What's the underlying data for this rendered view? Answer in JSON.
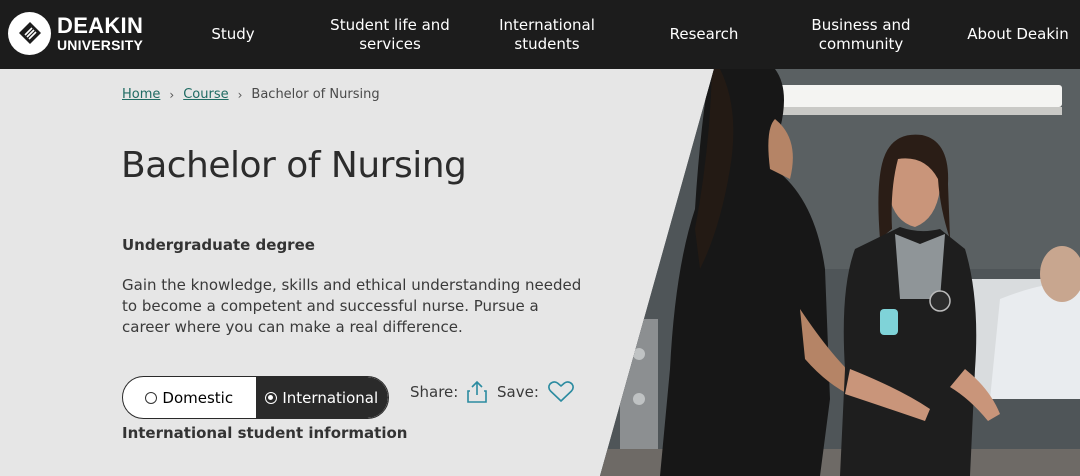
{
  "brand": {
    "name_line1": "DEAKIN",
    "name_line2": "UNIVERSITY"
  },
  "nav": {
    "items": [
      {
        "label": "Study"
      },
      {
        "label": "Student life and services"
      },
      {
        "label": "International students"
      },
      {
        "label": "Research"
      },
      {
        "label": "Business and community"
      },
      {
        "label": "About Deakin"
      }
    ]
  },
  "breadcrumb": {
    "home": "Home",
    "course": "Course",
    "current": "Bachelor of Nursing",
    "separator": "›"
  },
  "course": {
    "title": "Bachelor of Nursing",
    "degree_type": "Undergraduate degree",
    "description": "Gain the knowledge, skills and ethical understanding needed to become a competent and successful nurse. Pursue a career where you can make a real difference."
  },
  "student_toggle": {
    "options": [
      {
        "label": "Domestic",
        "selected": false
      },
      {
        "label": "International",
        "selected": true
      }
    ],
    "info_label": "International student information"
  },
  "actions": {
    "share_label": "Share:",
    "share_icon": "share-icon",
    "save_label": "Save:",
    "save_icon": "heart-icon"
  },
  "colors": {
    "nav_background": "#1c1c1c",
    "page_background": "#e6e6e6",
    "link": "#1f6b63",
    "icon_accent": "#2b8ba0",
    "toggle_active": "#2a2a2a"
  }
}
